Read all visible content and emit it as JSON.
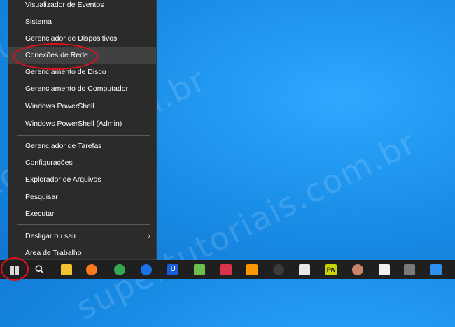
{
  "watermark": "supertutoriais.com.br",
  "menu": {
    "items": [
      {
        "label": "Visualizador de Eventos"
      },
      {
        "label": "Sistema"
      },
      {
        "label": "Gerenciador de Dispositivos"
      },
      {
        "label": "Conexões de Rede"
      },
      {
        "label": "Gerenciamento de Disco"
      },
      {
        "label": "Gerenciamento do Computador"
      },
      {
        "label": "Windows PowerShell"
      },
      {
        "label": "Windows PowerShell (Admin)"
      },
      {
        "label": "Gerenciador de Tarefas"
      },
      {
        "label": "Configurações"
      },
      {
        "label": "Explorador de Arquivos"
      },
      {
        "label": "Pesquisar"
      },
      {
        "label": "Executar"
      },
      {
        "label": "Desligar ou sair",
        "arrow": "›"
      },
      {
        "label": "Área de Trabalho"
      }
    ]
  },
  "taskbar": {
    "search_glyph": "⚲",
    "apps": [
      {
        "icon": "file-explorer-icon",
        "color": "#f2c230"
      },
      {
        "icon": "firefox-icon",
        "color": "#ff7a1a"
      },
      {
        "icon": "chrome-icon",
        "color": "#34a853"
      },
      {
        "icon": "chrome-beta-icon",
        "color": "#1a73e8"
      },
      {
        "icon": "bitwarden-icon",
        "color": "#175ddc",
        "glyph": "U"
      },
      {
        "icon": "notepad-icon",
        "color": "#6bbf4a"
      },
      {
        "icon": "paint-icon",
        "color": "#d8344a"
      },
      {
        "icon": "sublime-text-icon",
        "color": "#ff9800"
      },
      {
        "icon": "obs-icon",
        "color": "#3a3a3a"
      },
      {
        "icon": "inkscape-icon",
        "color": "#e8e8e8"
      },
      {
        "icon": "fireworks-icon",
        "color": "#c8d400",
        "glyph": "Fw"
      },
      {
        "icon": "gimp-icon",
        "color": "#c9836a"
      },
      {
        "icon": "cleaning-icon",
        "color": "#f0f0f0"
      },
      {
        "icon": "calculator-icon",
        "color": "#7a7a7a"
      },
      {
        "icon": "mail-icon",
        "color": "#2d8ff0"
      }
    ]
  },
  "colors": {
    "highlight": "#e0101e",
    "menu_bg": "#2b2b2b",
    "taskbar_bg": "#1f1f1f"
  }
}
